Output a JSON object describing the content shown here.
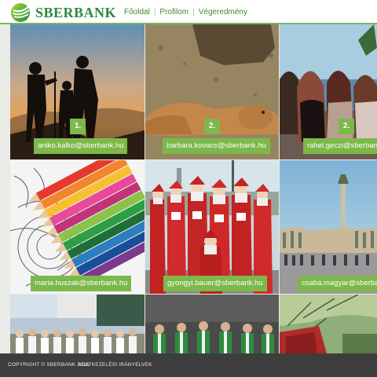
{
  "brand": {
    "name": "SBERBANK"
  },
  "nav": {
    "items": [
      {
        "label": "Főoldal"
      },
      {
        "label": "Profilom"
      },
      {
        "label": "Végeredmény"
      }
    ]
  },
  "tiles": [
    {
      "email": "aniko.kalko@sberbank.hu",
      "rank": "1."
    },
    {
      "email": "barbara.kovacs@sberbank.hu",
      "rank": "2."
    },
    {
      "email": "rahel.geczi@sberbank.hu",
      "rank": "2."
    },
    {
      "email": "maria.huszak@sberbank.hu"
    },
    {
      "email": "gyongyi.bauer@sberbank.hu"
    },
    {
      "email": "csaba.magyar@sberbank.hu"
    }
  ],
  "footer": {
    "copyright": "COPYRIGHT © SBERBANK 2015.",
    "privacy": "ADATKEZELÉSI IRÁNYELVEK"
  },
  "colors": {
    "accent": "#7db84a",
    "brand": "#2b8a3e",
    "footer": "#3d3d3d"
  }
}
